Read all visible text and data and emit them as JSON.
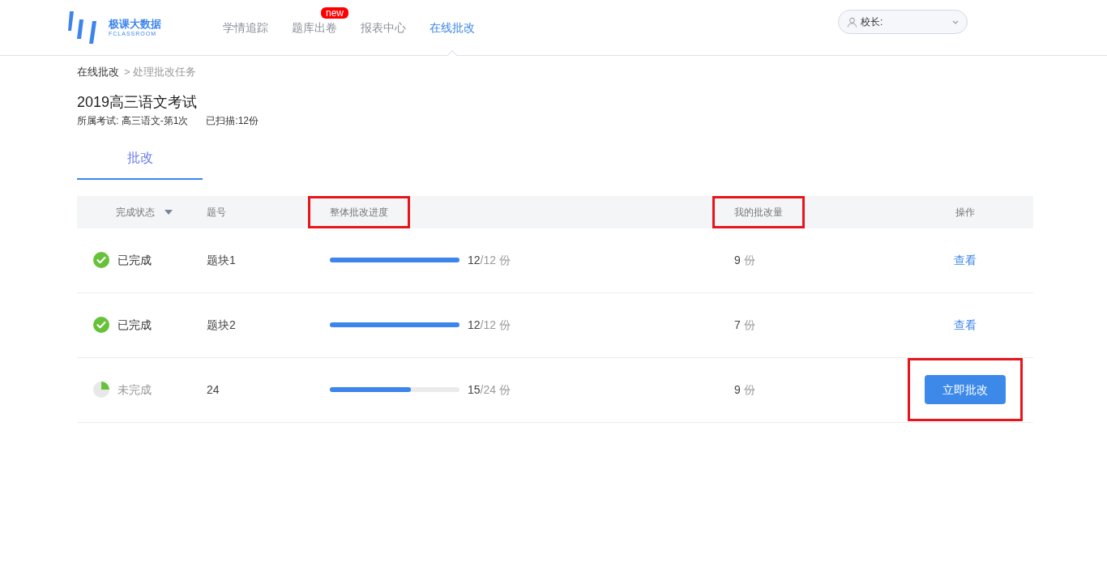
{
  "header": {
    "logo": {
      "name": "极课大数据",
      "sub": "FCLASSROOM"
    },
    "nav": [
      {
        "label": "学情追踪",
        "selected": false
      },
      {
        "label": "题库出卷",
        "selected": false,
        "badge": "new"
      },
      {
        "label": "报表中心",
        "selected": false
      },
      {
        "label": "在线批改",
        "selected": true
      }
    ],
    "user_menu": {
      "label": "校长:"
    }
  },
  "breadcrumb": {
    "parent": "在线批改",
    "current": "> 处理批改任务"
  },
  "exam": {
    "title": "2019高三语文考试",
    "meta": [
      "所属考试: 高三语文-第1次",
      "已扫描:12份"
    ]
  },
  "tabs": [
    {
      "label": "批改",
      "selected": true
    }
  ],
  "table": {
    "columns": [
      {
        "label": "完成状态",
        "sortable": true,
        "highlighted": false
      },
      {
        "label": "题号",
        "sortable": false,
        "highlighted": false
      },
      {
        "label": "整体批改进度",
        "sortable": false,
        "highlighted": true
      },
      {
        "label": "我的批改量",
        "sortable": false,
        "highlighted": true
      },
      {
        "label": "操作",
        "sortable": false,
        "highlighted": false
      }
    ],
    "rows": [
      {
        "status": {
          "kind": "done",
          "label": "已完成"
        },
        "question": "题块1",
        "progress": {
          "level": 1,
          "done": "12",
          "total": "/12 份"
        },
        "mine": {
          "count": "9",
          "unit": "份"
        },
        "action": {
          "kind": "link",
          "label": "查看",
          "highlighted": false
        }
      },
      {
        "status": {
          "kind": "done",
          "label": "已完成"
        },
        "question": "题块2",
        "progress": {
          "level": 1,
          "done": "12",
          "total": "/12 份"
        },
        "mine": {
          "count": "7",
          "unit": "份"
        },
        "action": {
          "kind": "link",
          "label": "查看",
          "highlighted": false
        }
      },
      {
        "status": {
          "kind": "pending",
          "label": "未完成"
        },
        "question": "24",
        "progress": {
          "level": 0.625,
          "done": "15",
          "total": "/24 份"
        },
        "mine": {
          "count": "9",
          "unit": "份"
        },
        "action": {
          "kind": "button",
          "label": "立即批改",
          "highlighted": true
        }
      }
    ]
  }
}
